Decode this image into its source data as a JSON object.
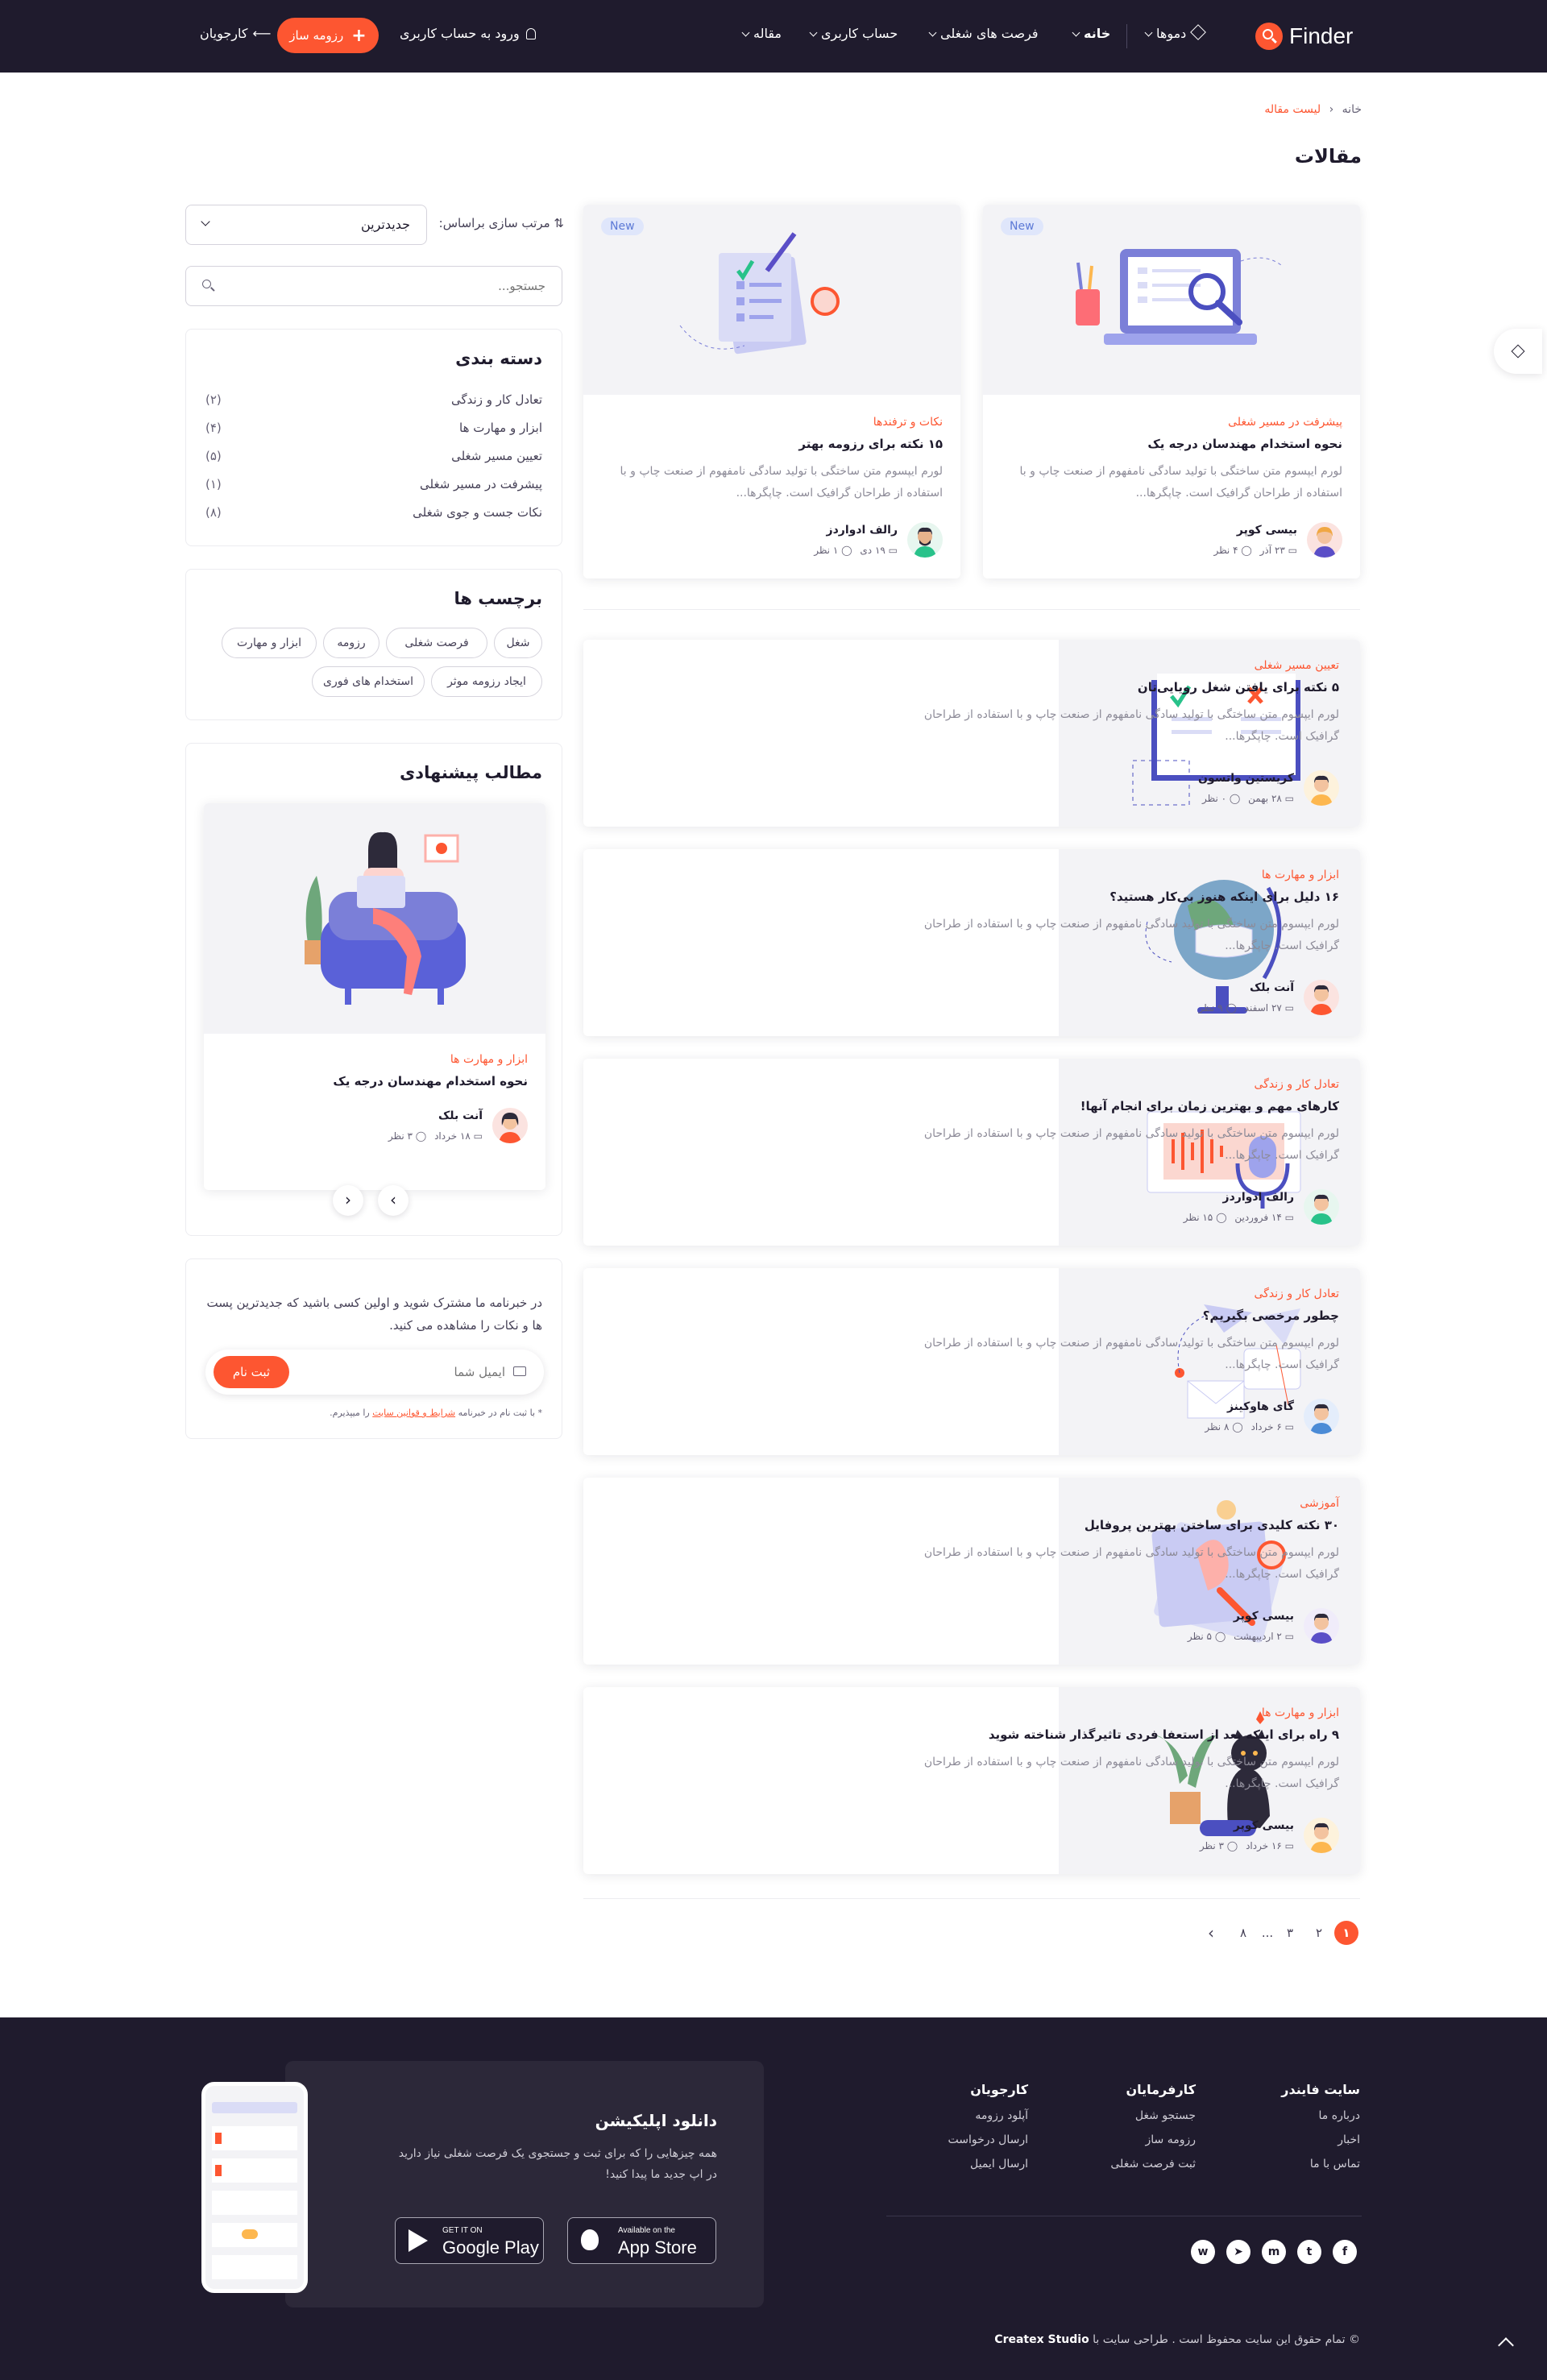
{
  "nav": {
    "brand": "Finder",
    "items": [
      {
        "label": "دموها"
      },
      {
        "label": "خانه"
      },
      {
        "label": "فرصت های شغلی"
      },
      {
        "label": "حساب کاربری"
      },
      {
        "label": "مقاله"
      }
    ],
    "login": "ورود به حساب کاربری",
    "resume_btn": "رزومه ساز",
    "resume_plus": "+",
    "employers": "کارجویان"
  },
  "breadcrumb": {
    "home": "خانه",
    "current": "لیست مقاله"
  },
  "page_title": "مقالات",
  "featured": [
    {
      "badge": "New",
      "category": "پیشرفت در مسیر شغلی",
      "title": "نحوه استخدام مهندسان درجه یک",
      "excerpt": "لورم ایپسوم متن ساختگی با تولید سادگی نامفهوم از صنعت چاپ و با استفاده از طراحان گرافیک است. چاپگرها...",
      "author": "بیسی کوپر",
      "date": "۲۳ آذر",
      "comments": "۴ نظر"
    },
    {
      "badge": "New",
      "category": "نکات و ترفندها",
      "title": "۱۵ نکته برای رزومه بهتر",
      "excerpt": "لورم ایپسوم متن ساختگی با تولید سادگی نامفهوم از صنعت چاپ و با استفاده از طراحان گرافیک است. چاپگرها...",
      "author": "رالف ادواردز",
      "date": "۱۹ دی",
      "comments": "۱ نظر"
    }
  ],
  "articles": [
    {
      "category": "تعیین مسیر شغلی",
      "title": "۵ نکته برای یافتن شغل رویایی‌تان",
      "excerpt": "لورم ایپسوم متن ساختگی با تولید سادگی نامفهوم از صنعت چاپ و با استفاده از طراحان گرافیک است. چاپگرها...",
      "author": "کریستین واتسون",
      "date": "۲۸ بهمن",
      "comments": "۰ نظر"
    },
    {
      "category": "ابزار و مهارت ها",
      "title": "۱۶ دلیل برای اینکه هنوز بی‌کار هستید؟",
      "excerpt": "لورم ایپسوم متن ساختگی با تولید سادگی نامفهوم از صنعت چاپ و با استفاده از طراحان گرافیک است. چاپگرها...",
      "author": "آنت بلک",
      "date": "۲۷ اسفند",
      "comments": "۹ نظر"
    },
    {
      "category": "تعادل کار و زندگی",
      "title": "کارهای مهم و بهترین زمان برای انجام آنها!",
      "excerpt": "لورم ایپسوم متن ساختگی با تولید سادگی نامفهوم از صنعت چاپ و با استفاده از طراحان گرافیک است. چاپگرها...",
      "author": "رالف ادواردز",
      "date": "۱۴ فروردین",
      "comments": "۱۵ نظر"
    },
    {
      "category": "تعادل کار و زندگی",
      "title": "چطور مرخصی بگیریم؟",
      "excerpt": "لورم ایپسوم متن ساختگی با تولید سادگی نامفهوم از صنعت چاپ و با استفاده از طراحان گرافیک است. چاپگرها...",
      "author": "گای هاوکینز",
      "date": "۶ خرداد",
      "comments": "۸ نظر"
    },
    {
      "category": "آموزشی",
      "title": "۳۰ نکته کلیدی برای ساختن بهترین پروفایل",
      "excerpt": "لورم ایپسوم متن ساختگی با تولید سادگی نامفهوم از صنعت چاپ و با استفاده از طراحان گرافیک است. چاپگرها...",
      "author": "بیسی کوپر",
      "date": "۲ اردیبهشت",
      "comments": "۵ نظر"
    },
    {
      "category": "ابزار و مهارت ها",
      "title": "۹ راه برای اینکه بعد از استعفا فردی تاثیرگذار شناخته شوید",
      "excerpt": "لورم ایپسوم متن ساختگی با تولید سادگی نامفهوم از صنعت چاپ و با استفاده از طراحان گرافیک است. چاپگرها...",
      "author": "بیسی کوپر",
      "date": "۱۶ خرداد",
      "comments": "۳ نظر"
    }
  ],
  "sort": {
    "label": "مرتب سازی براساس:",
    "value": "جدیدترین"
  },
  "search": {
    "placeholder": "جستجو..."
  },
  "categories": {
    "title": "دسته بندی",
    "items": [
      {
        "label": "تعادل کار و زندگی",
        "count": "(۲)"
      },
      {
        "label": "ابزار و مهارت ها",
        "count": "(۴)"
      },
      {
        "label": "تعیین مسیر شغلی",
        "count": "(۵)"
      },
      {
        "label": "پیشرفت در مسیر شغلی",
        "count": "(۱)"
      },
      {
        "label": "نکات جست و جوی شغلی",
        "count": "(۸)"
      }
    ]
  },
  "tags": {
    "title": "برچسب ها",
    "items": [
      "شغل",
      "فرصت شغلی",
      "رزومه",
      "ابزار و مهارت",
      "ایجاد رزومه موثر",
      "استخدام های فوری"
    ]
  },
  "suggested": {
    "title": "مطالب پیشنهادی",
    "category": "ابزار و مهارت ها",
    "post_title": "نحوه استخدام مهندسان درجه یک",
    "author": "آنت بلک",
    "date": "۱۸ خرداد",
    "comments": "۳ نظر"
  },
  "newsletter": {
    "text": "در خبرنامه ما مشترک شوید و اولین کسی باشید که جدیدترین پست ها و نکات را مشاهده می کنید.",
    "placeholder": "ایمیل شما",
    "button": "ثبت نام",
    "note_pre": "* با ثبت نام در خبرنامه",
    "note_link": "شرایط و قوانین سایت",
    "note_post": "را میپذیرم."
  },
  "pagination": {
    "pages": [
      "۱",
      "۲",
      "۳",
      "...",
      "۸"
    ]
  },
  "footer": {
    "columns": [
      {
        "title": "سایت فایندر",
        "links": [
          "درباره ما",
          "اخبار",
          "تماس با ما"
        ]
      },
      {
        "title": "کارفرمایان",
        "links": [
          "جستجو شغل",
          "رزومه ساز",
          "ثبت فرصت شغلی"
        ]
      },
      {
        "title": "کارجویان",
        "links": [
          "آپلود رزومه",
          "ارسال درخواست",
          "ارسال ایمیل"
        ]
      }
    ],
    "app_title": "دانلود اپلیکیشن",
    "app_text": "همه چیزهایی را که برای ثبت و جستجوی یک فرصت شغلی نیاز دارید در اپ جدید ما پیدا کنید!",
    "appstore_small": "Available on the",
    "appstore_big": "App Store",
    "gplay_small": "GET IT ON",
    "gplay_big": "Google Play",
    "copyright_pre": "© تمام حقوق این سایت محفوظ است . طراحی سایت با",
    "copyright_brand": "Createx Studio"
  },
  "colors": {
    "accent": "#fd5631",
    "dark": "#1f1b2d",
    "muted": "#8d8b98"
  }
}
